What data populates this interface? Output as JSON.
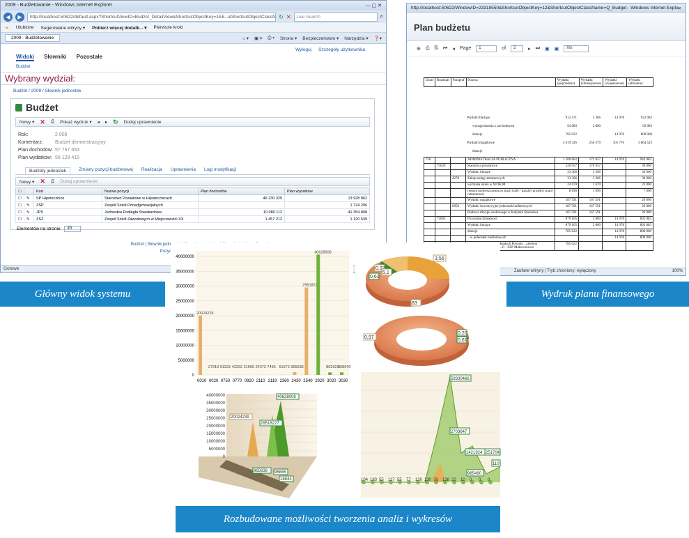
{
  "captions": {
    "main_view": "Główny widok systemu",
    "printout": "Wydruk planu finansowego",
    "analysis": "Rozbudowane możliwości tworzenia analiz i wykresów"
  },
  "browser1": {
    "window_title": "2009 - Budżetowanie - Windows Internet Explorer",
    "url": "http://localhost:50622/default.aspx?ShortcutViewID=Budzet_DetailView&ShortcutObjectKey=1E8...&ShortcutObjectClassName",
    "search_placeholder": "Live Search",
    "fav_label": "Ulubione",
    "fav_items": [
      "Sugerowane witryny ▾",
      "Pobierz więcej dodatk... ▾",
      "Pierwsze kroki"
    ],
    "tab_label": "2009 - Budżetowanie",
    "tools": [
      "Strona ▾",
      "Bezpieczeństwo ▾",
      "Narzędzia ▾"
    ],
    "status": "Gotowe"
  },
  "app": {
    "nav": [
      "Widoki",
      "Słowniki",
      "Pozostałe"
    ],
    "links": [
      "Wyloguj",
      "Szczegóły użytkownika"
    ],
    "crumb_top": "Budżet",
    "heading": "Wybrany wydział:",
    "crumb": "Budżet / 2009 / Słownik jednostek",
    "page_title": "Budżet",
    "toolbar": [
      "Nowy ▾",
      "Pokaż wydruk ▾",
      "Dodaj uprawnienie"
    ],
    "props": [
      {
        "label": "Rok:",
        "value": "2 009"
      },
      {
        "label": "Komentarz:",
        "value": "Budżet demonstracyjny"
      },
      {
        "label": "Plan dochodów:",
        "value": "57 767 653"
      },
      {
        "label": "Plan wydatków:",
        "value": "58 128 415"
      }
    ],
    "tabs": [
      "Budżety jednostek",
      "Zmiany pozycji budżetowej",
      "Realizacja",
      "Uprawnienia",
      "Logi modyfikacji"
    ],
    "inner_toolbar": [
      "Nowy ▾",
      "Dodaj uprawnienie"
    ],
    "columns": [
      "Kod",
      "Nazwa pozycji",
      "Plan dochodów",
      "Plan wydatków"
    ],
    "rows": [
      {
        "kod": "SP Hipotecznice",
        "nazwa": "Starostwo Powiatowe w Hipotecznicach",
        "dochody": "46 230 329",
        "wydatki": "13 928 862"
      },
      {
        "kod": "ZSP",
        "nazwa": "Zespół Szkół Ponadgimnazjalnych",
        "dochody": "",
        "wydatki": "1 724 206"
      },
      {
        "kod": "JPS",
        "nazwa": "Jednostka Podległa Standardowa",
        "dochody": "10 080 112",
        "wydatki": "41 354 808"
      },
      {
        "kod": "ZSZ",
        "nazwa": "Zespół Szkół Zawodowych w Miejscowości XX",
        "dochody": "1 457 212",
        "wydatki": "1 120 539"
      }
    ],
    "pager_label": "Elementów na stronie:",
    "pager_value": "20",
    "footer_line1": "Budżet  |  Słownik jednostek  |  Słownik wydziałów  |  Słownik działów  |  Słownik",
    "footer_line2": "Pozycja budżetu  |  Pozycja budżetu  |  Paragr"
  },
  "browser2": {
    "window_title": "http://localhost:50622/WindowID=23318550&ShortcutObjectKey=12&ShortcutObjectClassName=Q_Budget - Windows Internet Explo...",
    "report_title": "Plan budżetu",
    "page_label": "Page",
    "page_value": "1",
    "of_label": "of",
    "of_value": "2",
    "format": "Xls",
    "status": "Zaufane witryny | Tryb chroniony: wyłączony",
    "zoom": "100%",
    "headers": [
      "Dział",
      "Rozdział",
      "Paragraf",
      "Nazwa",
      "Wydatki (poprzednie)",
      "Wydatki (zmniejszenie)",
      "Wydatki (zwiększenie)",
      "Wydatki (aktualne)"
    ],
    "summary": [
      {
        "name": "Wydatki bieżące",
        "a": "912 471",
        "b": "3 366",
        "c": "14 978",
        "d": "922 083"
      },
      {
        "name": "wynagrodzenia z pochodnymi",
        "a": "94 083",
        "b": "2 000",
        "c": "",
        "d": "92 083"
      },
      {
        "name": "dotacje",
        "a": "785 022",
        "b": "",
        "c": "14 978",
        "d": "800 000"
      },
      {
        "name": "Wydatki majątkowe",
        "a": "4 019 326",
        "b": "256 379",
        "c": "101 776",
        "d": "3 864 523"
      },
      {
        "name": "dotacje",
        "a": "",
        "b": "",
        "c": "",
        "d": ""
      }
    ],
    "rows": [
      {
        "dz": "750",
        "roz": "",
        "par": "",
        "name": "ADMINISTRACJA PUBLICZNA",
        "a": "1 100 062",
        "b": "172 957",
        "c": "14 978",
        "d": "942 083"
      },
      {
        "dz": "",
        "roz": "75020",
        "par": "",
        "name": "Starostwa powiatowe",
        "a": "220 957",
        "b": "170 957",
        "c": "",
        "d": "30 000"
      },
      {
        "dz": "",
        "roz": "",
        "par": "",
        "name": "Wydatki bieżące",
        "a": "33 366",
        "b": "3 366",
        "c": "",
        "d": "30 000"
      },
      {
        "dz": "",
        "roz": "",
        "par": "4270",
        "name": "Zakup usług remontowych",
        "a": "33 366",
        "b": "3 366",
        "c": "",
        "d": "30 000"
      },
      {
        "dz": "",
        "roz": "",
        "par": "",
        "name": "wymiana okien w WOKiM",
        "a": "24 670",
        "b": "1 670",
        "c": "",
        "d": "23 000"
      },
      {
        "dz": "",
        "roz": "",
        "par": "",
        "name": "remont pomieszczenia po stacji trafo - garaże (projekt i prace remontowe)",
        "a": "8 696",
        "b": "1 696",
        "c": "",
        "d": "7 000"
      },
      {
        "dz": "",
        "roz": "",
        "par": "",
        "name": "Wydatki majątkowe",
        "a": "187 591",
        "b": "167 591",
        "c": "",
        "d": "20 000"
      },
      {
        "dz": "",
        "roz": "",
        "par": "6050",
        "name": "Wydatki inwestycyjne jednostek budżetowych",
        "a": "187 591",
        "b": "167 591",
        "c": "",
        "d": "20 000"
      },
      {
        "dz": "",
        "roz": "",
        "par": "",
        "name": "Budowa dźwigu osobowego w budynku Starostwa",
        "a": "187 591",
        "b": "167 591",
        "c": "",
        "d": "20 000"
      },
      {
        "dz": "",
        "roz": "75095",
        "par": "",
        "name": "Pozostała działalność",
        "a": "879 105",
        "b": "2 000",
        "c": "14 978",
        "d": "892 083"
      },
      {
        "dz": "",
        "roz": "",
        "par": "",
        "name": "Wydatki bieżące",
        "a": "879 105",
        "b": "2 000",
        "c": "14 978",
        "d": "892 083"
      },
      {
        "dz": "",
        "roz": "",
        "par": "",
        "name": "dotacje",
        "a": "785 022",
        "b": "",
        "c": "14 978",
        "d": "800 000"
      },
      {
        "dz": "",
        "roz": "",
        "par": "",
        "name": "...w jednostek budżetowych",
        "a": "",
        "b": "",
        "c": "14 978",
        "d": "800 000"
      },
      {
        "dz": "",
        "roz": "",
        "par": "",
        "name": "...podatku ciągłego w układach Powiatu ...stemem alternatywnych źródeł ...O - ZSP Makowskowo",
        "a": "785 022",
        "b": "",
        "c": "",
        "d": ""
      }
    ]
  },
  "chart_bar": {
    "yticks": [
      "0",
      "5000000",
      "10000000",
      "15000000",
      "20000000",
      "25000000",
      "30000000",
      "35000000",
      "40000000"
    ],
    "categories": [
      "0010",
      "0020",
      "0750",
      "0770",
      "0920",
      "2110",
      "2119",
      "2360",
      "2430",
      "2540",
      "2920",
      "3020",
      "3030"
    ],
    "labels": [
      "20024229",
      "27919",
      "51103",
      "42292",
      "21660",
      "24372",
      "7495",
      "61672",
      "965038",
      "29518227",
      "40628008",
      "862921",
      "868940"
    ]
  },
  "chart_donut": {
    "top_labels": [
      "3,56",
      "0,97",
      "0,61",
      "5,1",
      "83"
    ],
    "bottom_labels": [
      "0,97",
      "0,20",
      "0,61"
    ]
  },
  "chart_3d": {
    "yticks": [
      "0",
      "5000000",
      "10000000",
      "15000000",
      "20000000",
      "25000000",
      "30000000",
      "35000000",
      "40000000"
    ],
    "labels": [
      "20024239",
      "40628008",
      "29518227",
      "965838",
      "96885",
      "18844"
    ]
  },
  "chart_area": {
    "labels": [
      "59330466",
      "2703647",
      "1421924",
      "251704",
      "985490",
      "1042",
      "1035",
      "110"
    ],
    "bottom": [
      "104",
      "183",
      "55",
      "117",
      "55",
      "77",
      "120",
      "130",
      "76",
      "138",
      "22",
      "10",
      "0",
      "0",
      "0"
    ]
  }
}
